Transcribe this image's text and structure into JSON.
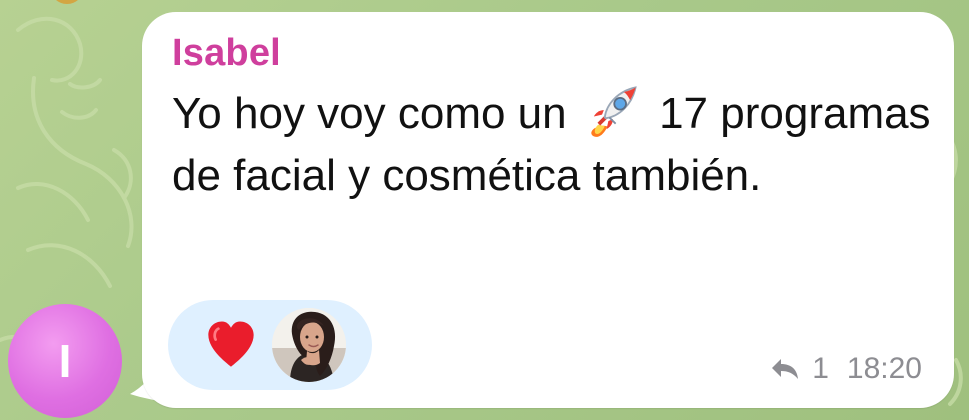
{
  "chat": {
    "sender_initial": "I",
    "message": {
      "sender_name": "Isabel",
      "text_before_emoji": "Yo hoy voy como un ",
      "emoji_icon": "rocket-emoji-icon",
      "text_after_emoji": " 17 programas de facial y cosmética también.",
      "reaction": {
        "icon": "red-heart-icon",
        "reactor_avatar_icon": "reactor-avatar"
      },
      "reply_count": "1",
      "time": "18:20"
    }
  },
  "colors": {
    "background": "#a9c98a",
    "bubble": "#ffffff",
    "sender_name": "#cf3f9d",
    "message_text": "#111111",
    "reaction_pill": "#dff0ff",
    "heart": "#ea1d2c",
    "meta_text": "#8d8d92",
    "avatar": "#df6fe2"
  }
}
